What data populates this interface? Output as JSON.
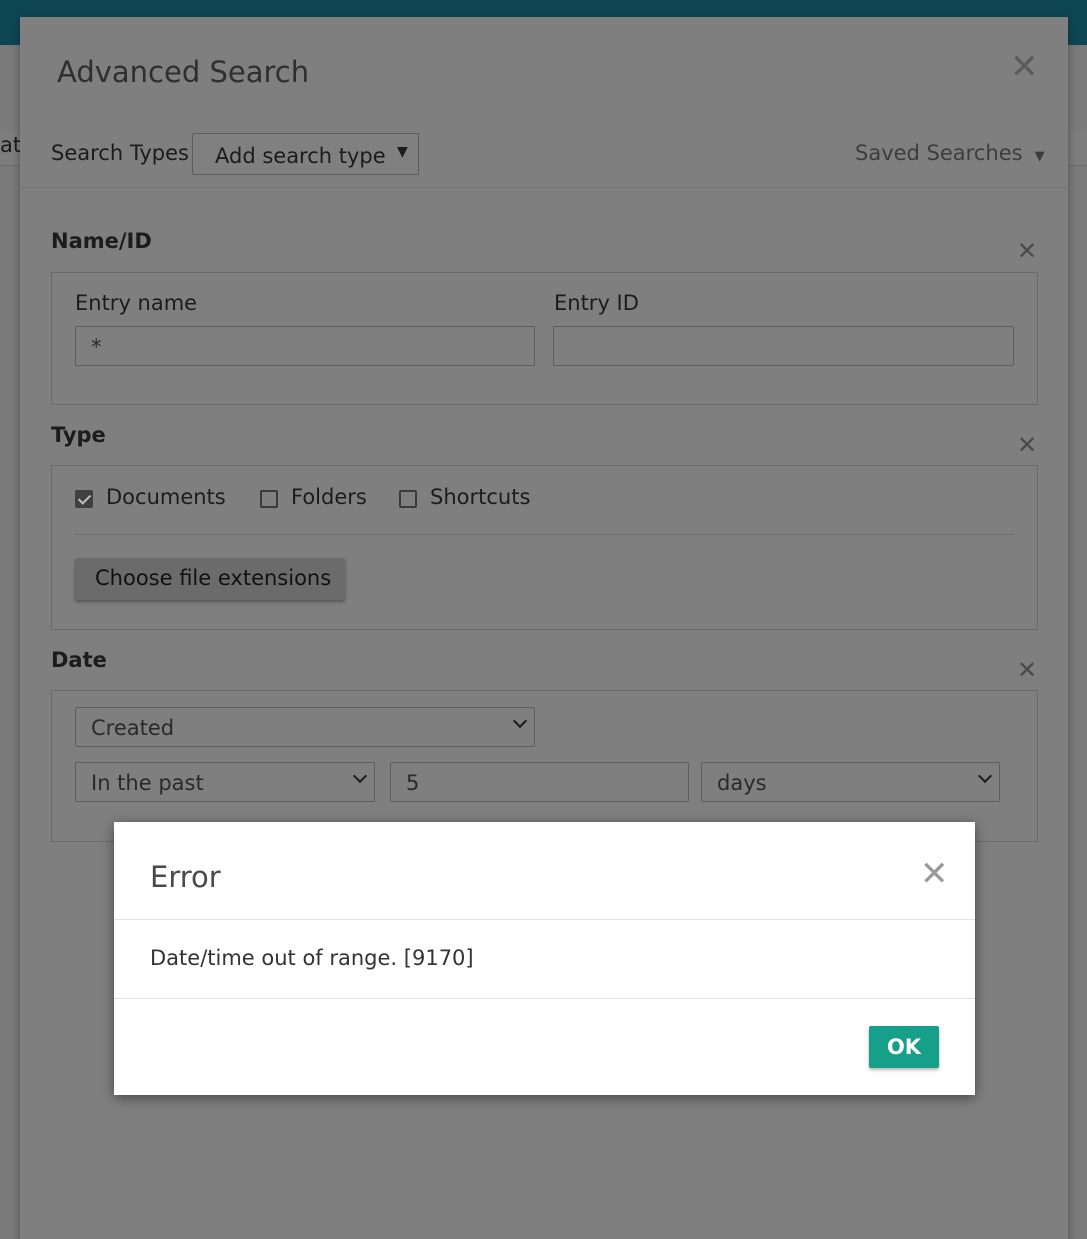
{
  "background": {
    "fragment_text": "at"
  },
  "advanced_search": {
    "title": "Advanced Search",
    "close_glyph": "✕",
    "search_types_label": "Search Types",
    "add_search_type": "Add search type",
    "saved_searches": "Saved Searches",
    "name_id": {
      "title": "Name/ID",
      "entry_name_label": "Entry name",
      "entry_name_value": "*",
      "entry_id_label": "Entry ID",
      "entry_id_value": ""
    },
    "type": {
      "title": "Type",
      "checkboxes": [
        {
          "label": "Documents",
          "checked": true
        },
        {
          "label": "Folders",
          "checked": false
        },
        {
          "label": "Shortcuts",
          "checked": false
        }
      ],
      "choose_extensions_label": "Choose file extensions"
    },
    "date": {
      "title": "Date",
      "field_select": "Created",
      "range_select": "In the past",
      "amount_value": "5",
      "unit_select": "days"
    }
  },
  "error_dialog": {
    "title": "Error",
    "message": "Date/time out of range. [9170]",
    "ok_label": "OK"
  },
  "colors": {
    "accent_teal": "#16a08a",
    "topbar": "#0e4753"
  }
}
